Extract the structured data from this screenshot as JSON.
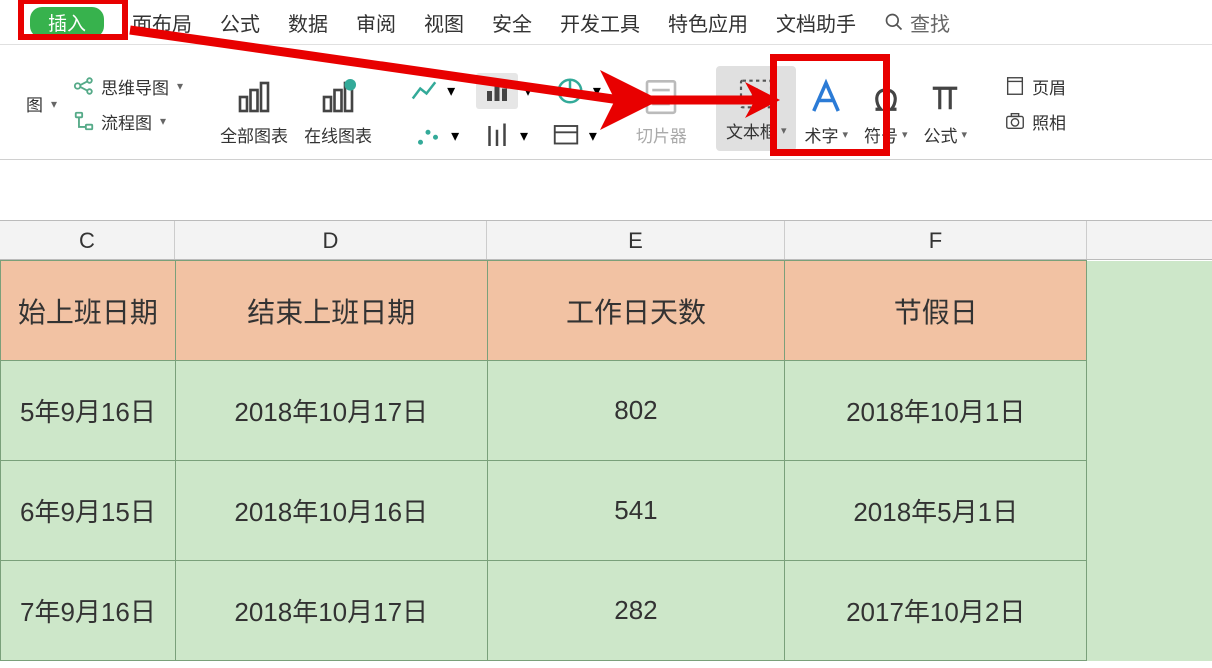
{
  "menu": {
    "insert": "插入",
    "pageLayout": "面布局",
    "pageLayoutPrefix": "面",
    "formula": "公式",
    "data": "数据",
    "review": "审阅",
    "view": "视图",
    "security": "安全",
    "developer": "开发工具",
    "special": "特色应用",
    "docAssistant": "文档助手",
    "search": "查找"
  },
  "ribbon": {
    "mindmap": "思维导图",
    "flowchart": "流程图",
    "imageTrail": "图",
    "allCharts": "全部图表",
    "onlineCharts": "在线图表",
    "slicer": "切片器",
    "textbox": "文本框",
    "wordart": "术字",
    "symbol": "符号",
    "equation": "公式",
    "headerFooter": "页眉",
    "camera": "照相"
  },
  "columns": [
    "C",
    "D",
    "E",
    "F"
  ],
  "headers": {
    "c": "始上班日期",
    "d": "结束上班日期",
    "e": "工作日天数",
    "f": "节假日"
  },
  "rows": [
    {
      "c": "5年9月16日",
      "d": "2018年10月17日",
      "e": "802",
      "f": "2018年10月1日"
    },
    {
      "c": "6年9月15日",
      "d": "2018年10月16日",
      "e": "541",
      "f": "2018年5月1日"
    },
    {
      "c": "7年9月16日",
      "d": "2018年10月17日",
      "e": "282",
      "f": "2017年10月2日"
    }
  ],
  "colors": {
    "highlight": "#e80000",
    "arrow": "#e80000",
    "headerBg": "#f2c2a3",
    "dataBg": "#cde7c9",
    "insertTab": "#37b24d"
  }
}
